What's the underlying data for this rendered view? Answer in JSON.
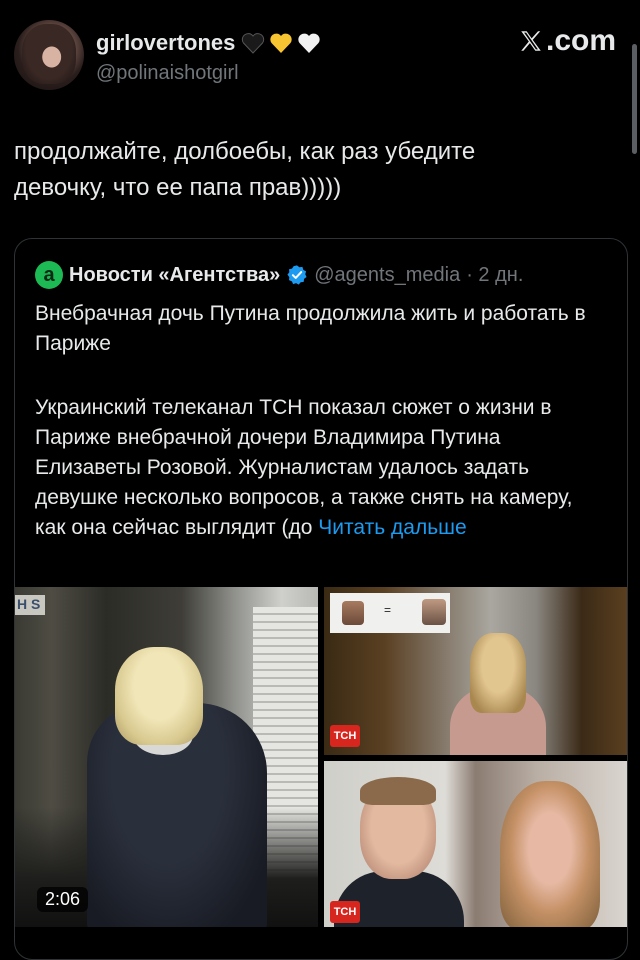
{
  "author": {
    "display_name": "girlovertones",
    "handle": "@polinaishotgirl",
    "emoji_hearts": [
      "black-heart",
      "yellow-heart",
      "white-heart"
    ]
  },
  "site": {
    "logo_text": ".com"
  },
  "tweet": {
    "text": "продолжайте, долбоебы, как раз убедите девочку, что ее папа прав)))))"
  },
  "quoted": {
    "source_name": "Новости «Агентства»",
    "handle": "@agents_media",
    "time": "· 2 дн.",
    "title": "Внебрачная дочь Путина продолжила жить и работать в Париже",
    "body": "Украинский телеканал ТСН показал сюжет о жизни в Париже внебрачной дочери Владимира Путина Елизаветы Розовой. Журналистам удалось задать девушке несколько вопросов, а также снять на камеру, как она сейчас выглядит (до",
    "read_more": "Читать дальше",
    "video_duration": "2:06",
    "channel_badge": "ТСН",
    "colors": {
      "verified": "#1d9bf0",
      "logo": "#1db954",
      "link": "#1d9bf0"
    }
  }
}
